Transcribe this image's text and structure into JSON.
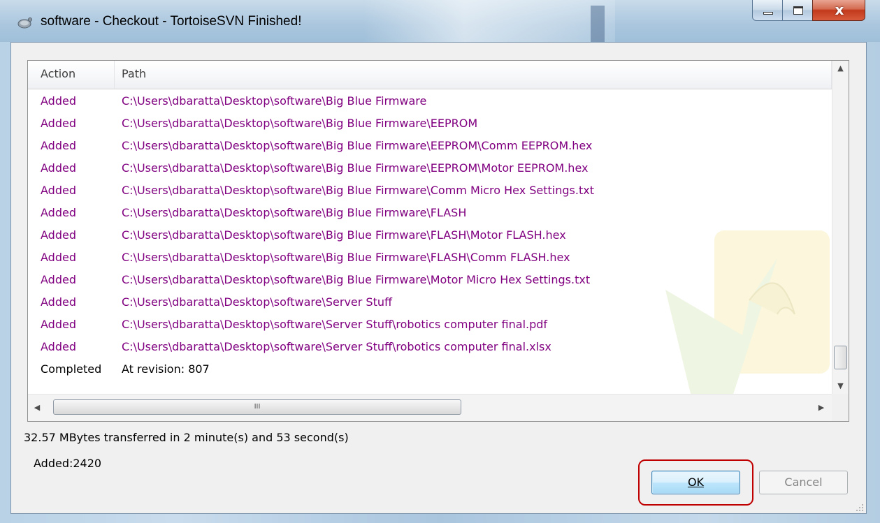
{
  "window": {
    "title": "software - Checkout - TortoiseSVN Finished!",
    "close_glyph": "x"
  },
  "list": {
    "columns": {
      "action": "Action",
      "path": "Path"
    },
    "rows": [
      {
        "action": "Added",
        "path": "C:\\Users\\dbaratta\\Desktop\\software\\Big Blue Firmware",
        "status": "added"
      },
      {
        "action": "Added",
        "path": "C:\\Users\\dbaratta\\Desktop\\software\\Big Blue Firmware\\EEPROM",
        "status": "added"
      },
      {
        "action": "Added",
        "path": "C:\\Users\\dbaratta\\Desktop\\software\\Big Blue Firmware\\EEPROM\\Comm EEPROM.hex",
        "status": "added"
      },
      {
        "action": "Added",
        "path": "C:\\Users\\dbaratta\\Desktop\\software\\Big Blue Firmware\\EEPROM\\Motor EEPROM.hex",
        "status": "added"
      },
      {
        "action": "Added",
        "path": "C:\\Users\\dbaratta\\Desktop\\software\\Big Blue Firmware\\Comm Micro Hex Settings.txt",
        "status": "added"
      },
      {
        "action": "Added",
        "path": "C:\\Users\\dbaratta\\Desktop\\software\\Big Blue Firmware\\FLASH",
        "status": "added"
      },
      {
        "action": "Added",
        "path": "C:\\Users\\dbaratta\\Desktop\\software\\Big Blue Firmware\\FLASH\\Motor FLASH.hex",
        "status": "added"
      },
      {
        "action": "Added",
        "path": "C:\\Users\\dbaratta\\Desktop\\software\\Big Blue Firmware\\FLASH\\Comm FLASH.hex",
        "status": "added"
      },
      {
        "action": "Added",
        "path": "C:\\Users\\dbaratta\\Desktop\\software\\Big Blue Firmware\\Motor Micro Hex Settings.txt",
        "status": "added"
      },
      {
        "action": "Added",
        "path": "C:\\Users\\dbaratta\\Desktop\\software\\Server Stuff",
        "status": "added"
      },
      {
        "action": "Added",
        "path": "C:\\Users\\dbaratta\\Desktop\\software\\Server Stuff\\robotics computer final.pdf",
        "status": "added"
      },
      {
        "action": "Added",
        "path": "C:\\Users\\dbaratta\\Desktop\\software\\Server Stuff\\robotics computer final.xlsx",
        "status": "added"
      },
      {
        "action": "Completed",
        "path": "At revision: 807",
        "status": "completed"
      }
    ],
    "hscroll_thumb_glyph": "III"
  },
  "summary": {
    "transfer": "32.57 MBytes transferred in 2 minute(s) and 53 second(s)",
    "counts": "Added:2420"
  },
  "buttons": {
    "ok": "OK",
    "cancel": "Cancel"
  },
  "colors": {
    "added_text": "#800080",
    "completed_text": "#000000",
    "highlight_box": "#c00000"
  }
}
